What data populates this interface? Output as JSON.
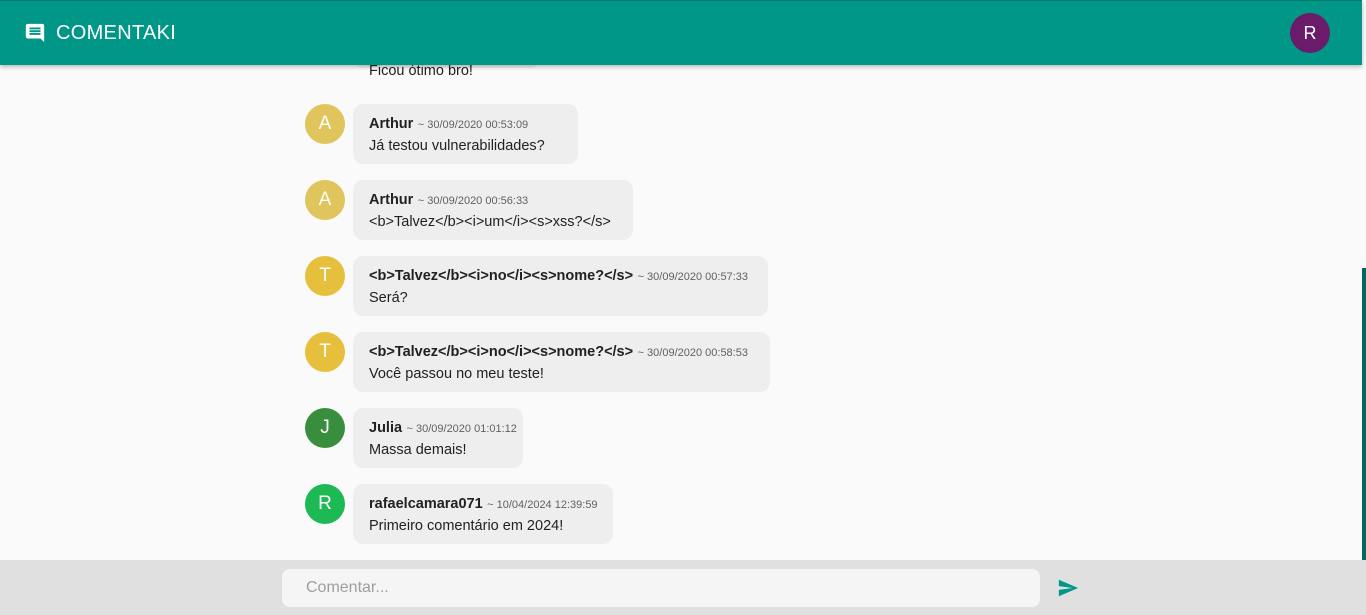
{
  "app": {
    "title": "COMENTAKI",
    "icon": "comment-icon",
    "brand_color": "#009688"
  },
  "user": {
    "initial": "R",
    "avatar_color": "#6a1b6a"
  },
  "comments": [
    {
      "initial": "",
      "avatar_color": "#e0c45c",
      "author": "",
      "timestamp": "",
      "text": "Ficou ótimo bro!"
    },
    {
      "initial": "A",
      "avatar_color": "#e0c45c",
      "author": "Arthur",
      "timestamp": "~ 30/09/2020 00:53:09",
      "text": "Já testou vulnerabilidades?"
    },
    {
      "initial": "A",
      "avatar_color": "#e0c45c",
      "author": "Arthur",
      "timestamp": "~ 30/09/2020 00:56:33",
      "text": "<b>Talvez</b><i>um</i><s>xss?</s>"
    },
    {
      "initial": "T",
      "avatar_color": "#e6bf3c",
      "author": "<b>Talvez</b><i>no</i><s>nome?</s>",
      "timestamp": "~ 30/09/2020 00:57:33",
      "text": "Será?"
    },
    {
      "initial": "T",
      "avatar_color": "#e6bf3c",
      "author": "<b>Talvez</b><i>no</i><s>nome?</s>",
      "timestamp": "~ 30/09/2020 00:58:53",
      "text": "Você passou no meu teste!"
    },
    {
      "initial": "J",
      "avatar_color": "#388e3c",
      "author": "Julia",
      "timestamp": "~ 30/09/2020 01:01:12",
      "text": "Massa demais!"
    },
    {
      "initial": "R",
      "avatar_color": "#1db954",
      "author": "rafaelcamara071",
      "timestamp": "~ 10/04/2024 12:39:59",
      "text": "Primeiro comentário em 2024!"
    }
  ],
  "composer": {
    "placeholder": "Comentar...",
    "value": "",
    "send_icon": "send-icon",
    "send_color": "#009688"
  }
}
